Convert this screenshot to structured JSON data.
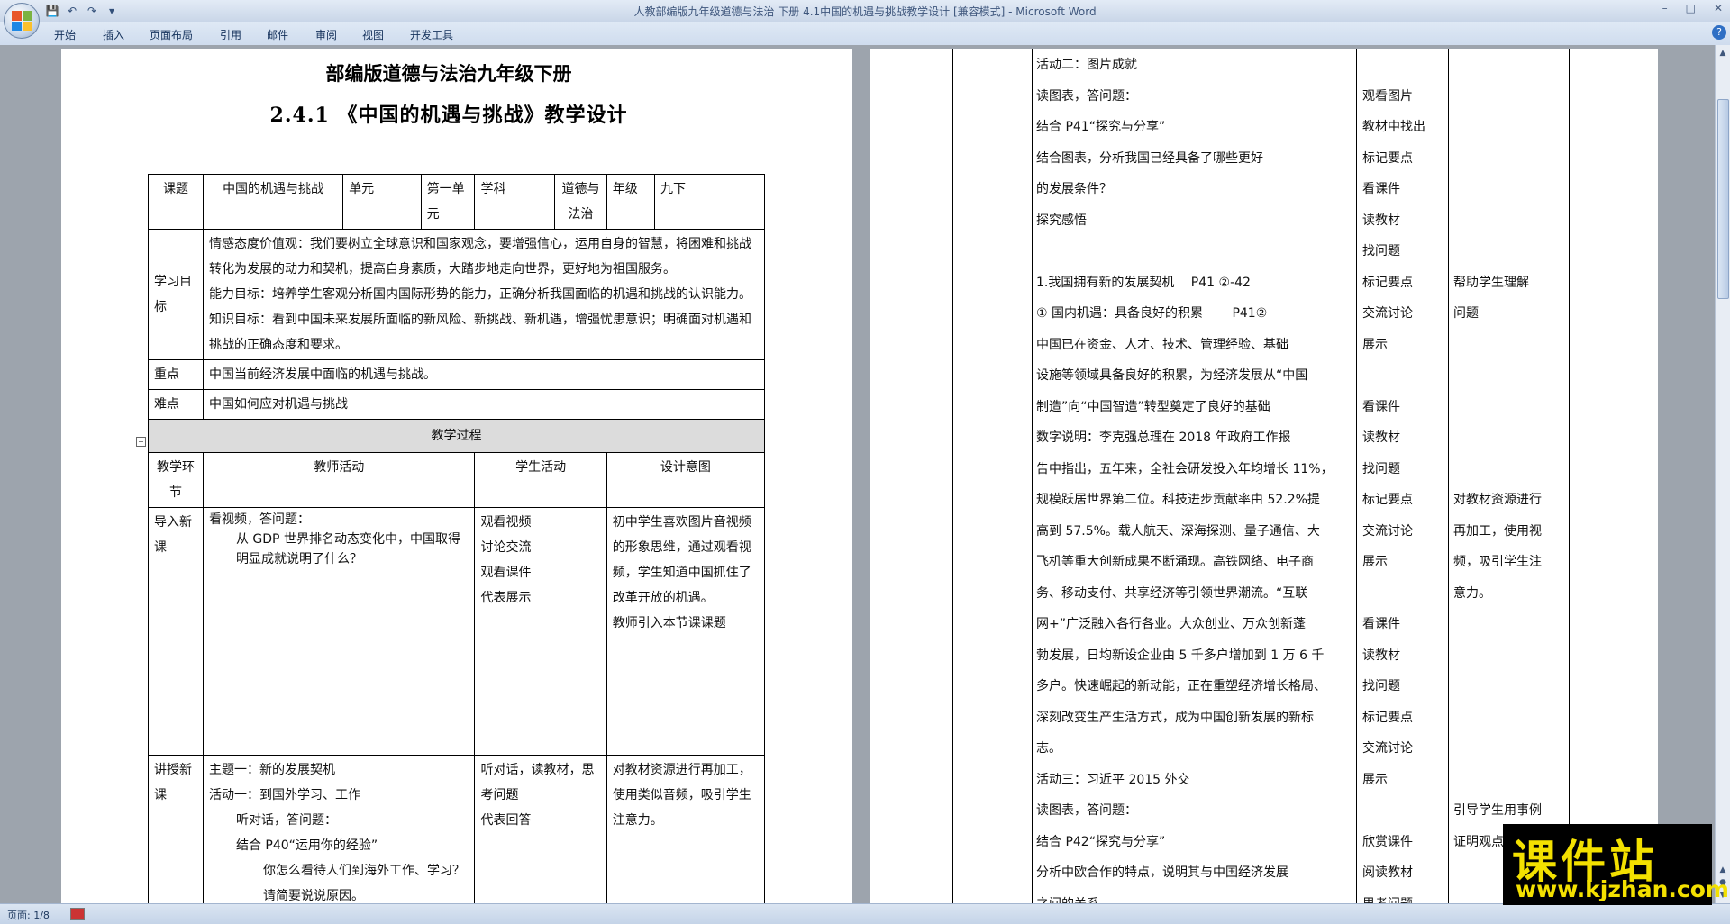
{
  "window": {
    "title": "人教部编版九年级道德与法治 下册 4.1中国的机遇与挑战教学设计 [兼容模式] - Microsoft Word",
    "controls": [
      "–",
      "□",
      "✕"
    ]
  },
  "qat": {
    "save": "💾",
    "undo": "↶",
    "redo": "↷",
    "more": "▾"
  },
  "ribbon": {
    "tabs": [
      "开始",
      "插入",
      "页面布局",
      "引用",
      "邮件",
      "审阅",
      "视图",
      "开发工具"
    ],
    "help": "?"
  },
  "doc": {
    "heading1": "部编版道德与法治九年级下册",
    "heading2": "2.4.1 《中国的机遇与挑战》教学设计",
    "info": {
      "c1": "课题",
      "c2": "中国的机遇与挑战",
      "c3": "单元",
      "c4": "第一单元",
      "c5": "学科",
      "c6": "道德与法治",
      "c7": "年级",
      "c8": "九下"
    },
    "goals_label": "学习目标",
    "goals": [
      "情感态度价值观：我们要树立全球意识和国家观念，要增强信心，运用自身的智慧，将困难和挑战转化为发展的动力和契机，提高自身素质，大踏步地走向世界，更好地为祖国服务。",
      "能力目标：培养学生客观分析国内国际形势的能力，正确分析我国面临的机遇和挑战的认识能力。",
      "知识目标：看到中国未来发展所面临的新风险、新挑战、新机遇，增强忧患意识；明确面对机遇和挑战的正确态度和要求。"
    ],
    "key_label": "重点",
    "key": "中国当前经济发展中面临的机遇与挑战。",
    "diff_label": "难点",
    "diff": "中国如何应对机遇与挑战",
    "process_title": "教学过程",
    "process_headers": [
      "教学环节",
      "教师活动",
      "学生活动",
      "设计意图"
    ],
    "rows": [
      {
        "stage": "导入新课",
        "teacher": [
          "看视频，答问题：",
          "从 GDP 世界排名动态变化中，中国取得明显成就说明了什么？"
        ],
        "student": [
          "观看视频",
          "讨论交流",
          "观看课件",
          "代表展示"
        ],
        "intent": [
          "初中学生喜欢图片音视频的形象思维，通过观看视频，学生知道中国抓住了改革开放的机遇。",
          "教师引入本节课课题"
        ]
      },
      {
        "stage": "讲授新课",
        "teacher": [
          "主题一：新的发展契机",
          "活动一：到国外学习、工作",
          "听对话，答问题：",
          "结合 P40“运用你的经验”",
          "你怎么看待人们到海外工作、学习？请简要说说原因。"
        ],
        "student": [
          "听对话，读教材，思考问题",
          "代表回答"
        ],
        "intent": [
          "对教材资源进行再加工，使用类似音频，吸引学生注意力。"
        ]
      }
    ],
    "p2_lines": [
      {
        "t": "活动二：图片成就",
        "s": "",
        "i": ""
      },
      {
        "t": "读图表，答问题：",
        "s": "观看图片",
        "i": ""
      },
      {
        "t": "结合 P41“探究与分享”",
        "s": "教材中找出",
        "i": ""
      },
      {
        "t": "结合图表，分析我国已经具备了哪些更好",
        "s": "标记要点",
        "i": ""
      },
      {
        "t": "的发展条件？",
        "s": "看课件",
        "i": ""
      },
      {
        "t": "探究感悟",
        "s": "读教材",
        "i": ""
      },
      {
        "t": "",
        "s": "找问题",
        "i": ""
      },
      {
        "t": "1.我国拥有新的发展契机　 P41 ②-42",
        "s": "标记要点",
        "i": "帮助学生理解"
      },
      {
        "t": "① 国内机遇：具备良好的积累　　 P41②",
        "s": "交流讨论",
        "i": "问题"
      },
      {
        "t": "中国已在资金、人才、技术、管理经验、基础",
        "s": "展示",
        "i": ""
      },
      {
        "t": "设施等领域具备良好的积累，为经济发展从“中国",
        "s": "",
        "i": ""
      },
      {
        "t": "制造”向“中国智造”转型奠定了良好的基础",
        "s": "看课件",
        "i": ""
      },
      {
        "t": "数字说明：李克强总理在 2018 年政府工作报",
        "s": "读教材",
        "i": ""
      },
      {
        "t": "告中指出，五年来，全社会研发投入年均增长 11%，",
        "s": "找问题",
        "i": ""
      },
      {
        "t": "规模跃居世界第二位。科技进步贡献率由 52.2%提",
        "s": "标记要点",
        "i": "对教材资源进行"
      },
      {
        "t": "高到 57.5%。载人航天、深海探测、量子通信、大",
        "s": "交流讨论",
        "i": "再加工，使用视"
      },
      {
        "t": "飞机等重大创新成果不断涌现。高铁网络、电子商",
        "s": "展示",
        "i": "频，吸引学生注"
      },
      {
        "t": "务、移动支付、共享经济等引领世界潮流。“互联",
        "s": "",
        "i": "意力。"
      },
      {
        "t": "网+”广泛融入各行各业。大众创业、万众创新蓬",
        "s": "看课件",
        "i": ""
      },
      {
        "t": "勃发展，日均新设企业由 5 千多户增加到 1 万 6 千",
        "s": "读教材",
        "i": ""
      },
      {
        "t": "多户。快速崛起的新动能，正在重塑经济增长格局、",
        "s": "找问题",
        "i": ""
      },
      {
        "t": "深刻改变生产生活方式，成为中国创新发展的新标",
        "s": "标记要点",
        "i": ""
      },
      {
        "t": "志。",
        "s": "交流讨论",
        "i": ""
      },
      {
        "t": "活动三：习近平 2015 外交",
        "s": "展示",
        "i": ""
      },
      {
        "t": "读图表，答问题：",
        "s": "",
        "i": "引导学生用事例"
      },
      {
        "t": "结合 P42“探究与分享”",
        "s": "欣赏课件",
        "i": "证明观点"
      },
      {
        "t": "分析中欧合作的特点，说明其与中国经济发展",
        "s": "阅读教材",
        "i": ""
      },
      {
        "t": "之间的关系。",
        "s": "思考问题",
        "i": ""
      }
    ]
  },
  "status": {
    "page": "页面: 1/8"
  },
  "watermark": {
    "cn": "课件站",
    "url": "www.kjzhan.com"
  },
  "colors": {
    "accent": "#15325c",
    "page_bg": "#9da4ad",
    "watermark_fg": "#f3e000"
  }
}
